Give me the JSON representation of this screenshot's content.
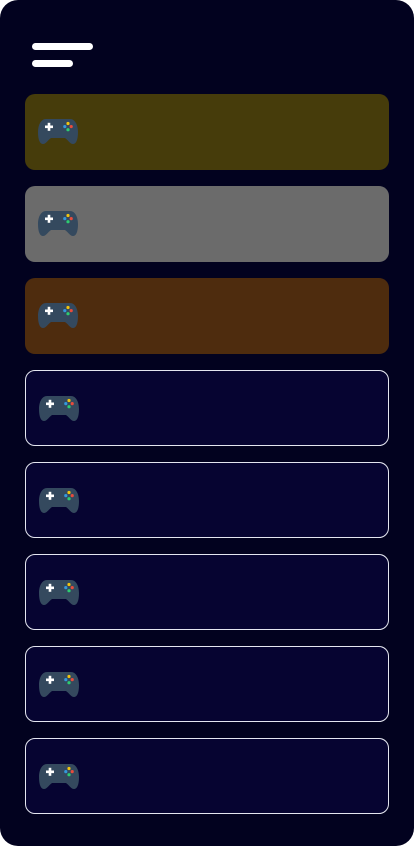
{
  "app": {
    "menu_icon": "hamburger-menu-icon",
    "colors": {
      "background": "#02021f",
      "controller_body": "#34495e",
      "controller_dpad": "#ffffff",
      "button_red": "#e74c3c",
      "button_green": "#2ecc71",
      "button_blue": "#3498db",
      "button_yellow": "#f1c40f"
    }
  },
  "games": {
    "icon": "gamepad-icon",
    "items": [
      {
        "title": "",
        "color": "#463c0b",
        "style": "filled"
      },
      {
        "title": "",
        "color": "#6b6b6b",
        "style": "filled"
      },
      {
        "title": "",
        "color": "#4e2c0e",
        "style": "filled"
      },
      {
        "title": "",
        "color": "#060431",
        "style": "outlined"
      },
      {
        "title": "",
        "color": "#060431",
        "style": "outlined"
      },
      {
        "title": "",
        "color": "#060431",
        "style": "outlined"
      },
      {
        "title": "",
        "color": "#060431",
        "style": "outlined"
      },
      {
        "title": "",
        "color": "#060431",
        "style": "outlined"
      }
    ]
  }
}
